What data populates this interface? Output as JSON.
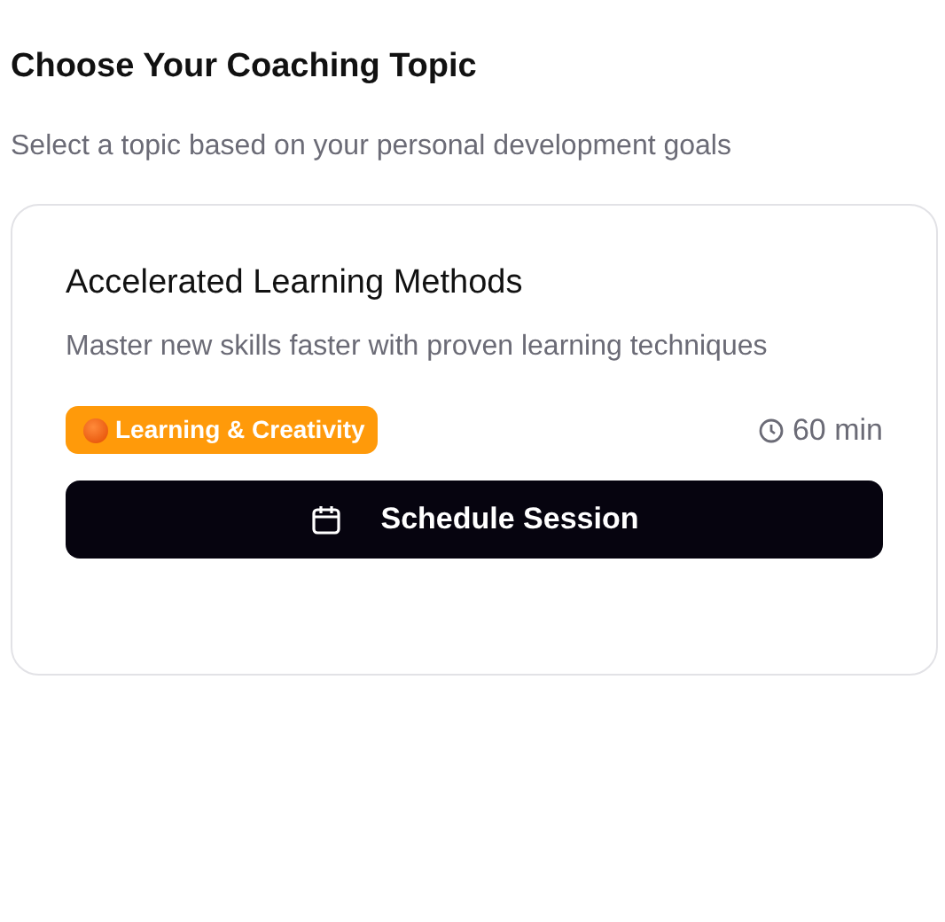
{
  "heading": "Choose Your Coaching Topic",
  "subheading": "Select a topic based on your personal development goals",
  "topic": {
    "title": "Accelerated Learning Methods",
    "description": "Master new skills faster with proven learning techniques",
    "category": "Learning & Creativity",
    "duration": "60 min",
    "button": "Schedule Session"
  }
}
